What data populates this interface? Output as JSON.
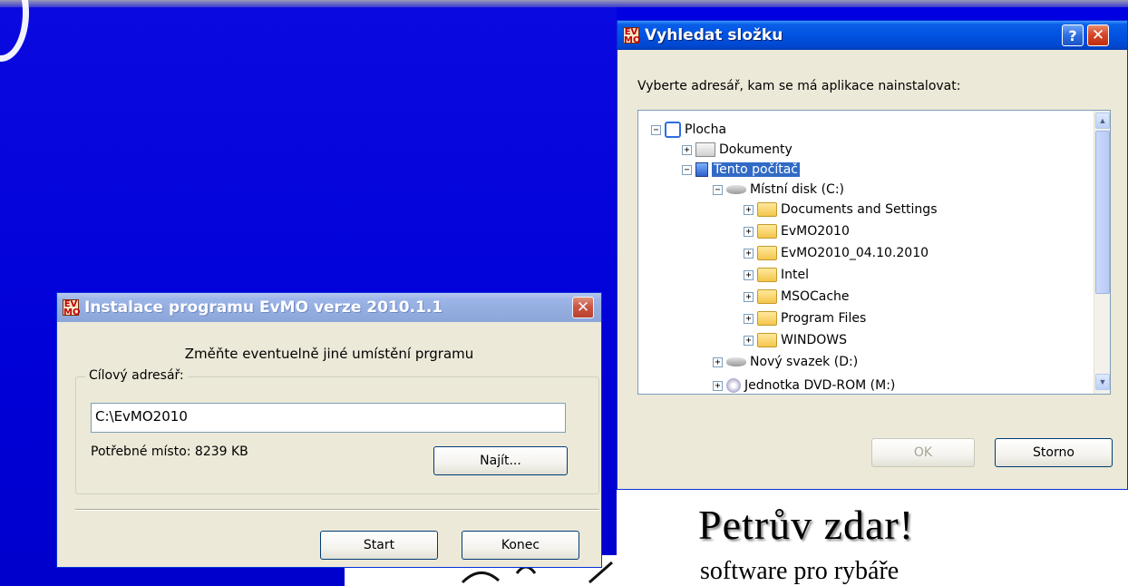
{
  "folder_dialog": {
    "title": "Vyhledat složku",
    "app_icon": "EV MO",
    "help_glyph": "?",
    "close_glyph": "✕",
    "prompt": "Vyberte adresář, kam se má aplikace nainstalovat:",
    "tree": [
      {
        "label": "Plocha",
        "icon": "desktop-icon",
        "expander": "−"
      },
      {
        "label": "Dokumenty",
        "icon": "documents-icon",
        "expander": "+"
      },
      {
        "label": "Tento počítač",
        "icon": "computer-icon",
        "expander": "−",
        "selected": true
      },
      {
        "label": "Místní disk (C:)",
        "icon": "drive-icon",
        "expander": "−"
      },
      {
        "label": "Documents and Settings",
        "icon": "folder-icon",
        "expander": "+"
      },
      {
        "label": "EvMO2010",
        "icon": "folder-icon",
        "expander": "+"
      },
      {
        "label": "EvMO2010_04.10.2010",
        "icon": "folder-icon",
        "expander": "+"
      },
      {
        "label": "Intel",
        "icon": "folder-icon",
        "expander": "+"
      },
      {
        "label": "MSOCache",
        "icon": "folder-icon",
        "expander": "+"
      },
      {
        "label": "Program Files",
        "icon": "folder-icon",
        "expander": "+"
      },
      {
        "label": "WINDOWS",
        "icon": "folder-icon",
        "expander": "+"
      },
      {
        "label": "Nový svazek (D:)",
        "icon": "drive-icon",
        "expander": "+"
      },
      {
        "label": "Jednotka DVD-ROM (M:)",
        "icon": "dvd-icon",
        "expander": "+"
      }
    ],
    "ok_label": "OK",
    "cancel_label": "Storno"
  },
  "install_dialog": {
    "title": "Instalace programu EvMO verze 2010.1.1",
    "app_icon": "EV MO",
    "close_glyph": "✕",
    "heading": "Změňte eventuelně jiné umístění prgramu",
    "group_label": "Cílový adresář:",
    "path_value": "C:\\EvMO2010",
    "space_needed": "Potřebné místo: 8239 KB",
    "browse_label": "Najít...",
    "start_label": "Start",
    "exit_label": "Konec"
  },
  "background": {
    "brand_title": "Petrův zdar!",
    "brand_subtitle": "software pro rybáře",
    "accent_color": "#0000dd"
  }
}
